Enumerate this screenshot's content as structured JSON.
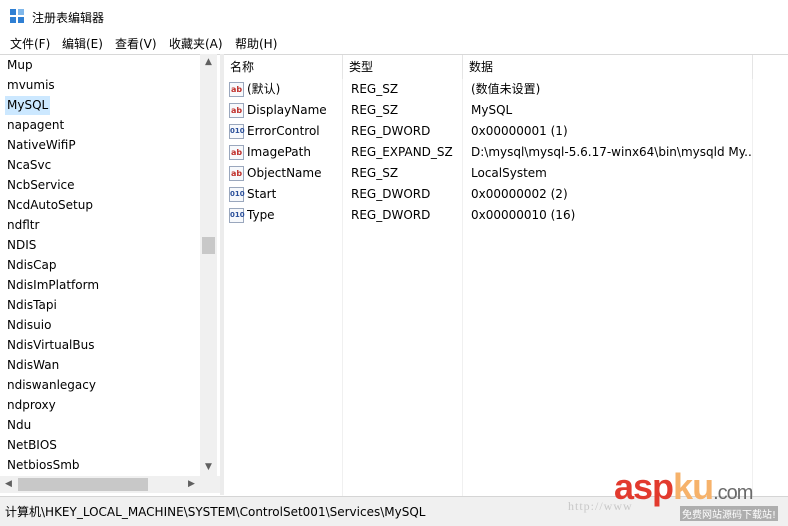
{
  "window": {
    "title": "注册表编辑器",
    "icon": "regedit-icon"
  },
  "menu": [
    "文件(F)",
    "编辑(E)",
    "查看(V)",
    "收藏夹(A)",
    "帮助(H)"
  ],
  "tree": {
    "items": [
      "Mup",
      "mvumis",
      "MySQL",
      "napagent",
      "NativeWifiP",
      "NcaSvc",
      "NcbService",
      "NcdAutoSetup",
      "ndfltr",
      "NDIS",
      "NdisCap",
      "NdisImPlatform",
      "NdisTapi",
      "Ndisuio",
      "NdisVirtualBus",
      "NdisWan",
      "ndiswanlegacy",
      "ndproxy",
      "Ndu",
      "NetBIOS",
      "NetbiosSmb"
    ],
    "selected": "MySQL"
  },
  "list": {
    "columns": [
      "名称",
      "类型",
      "数据"
    ],
    "rows": [
      {
        "icon": "string-value-icon",
        "name": "(默认)",
        "type": "REG_SZ",
        "data": "(数值未设置)"
      },
      {
        "icon": "string-value-icon",
        "name": "DisplayName",
        "type": "REG_SZ",
        "data": "MySQL"
      },
      {
        "icon": "dword-value-icon",
        "name": "ErrorControl",
        "type": "REG_DWORD",
        "data": "0x00000001 (1)"
      },
      {
        "icon": "string-value-icon",
        "name": "ImagePath",
        "type": "REG_EXPAND_SZ",
        "data": "D:\\mysql\\mysql-5.6.17-winx64\\bin\\mysqld My..."
      },
      {
        "icon": "string-value-icon",
        "name": "ObjectName",
        "type": "REG_SZ",
        "data": "LocalSystem"
      },
      {
        "icon": "dword-value-icon",
        "name": "Start",
        "type": "REG_DWORD",
        "data": "0x00000002 (2)"
      },
      {
        "icon": "dword-value-icon",
        "name": "Type",
        "type": "REG_DWORD",
        "data": "0x00000010 (16)"
      }
    ]
  },
  "status": {
    "path": "计算机\\HKEY_LOCAL_MACHINE\\SYSTEM\\ControlSet001\\Services\\MySQL"
  },
  "watermark": {
    "url": "http://www",
    "logo_a": "asp",
    "logo_b": "ku",
    "logo_c": ".com",
    "subtitle": "免费网站源码下载站!"
  },
  "colors": {
    "selection": "#cce8ff",
    "watermark_red": "#e23a2e"
  }
}
